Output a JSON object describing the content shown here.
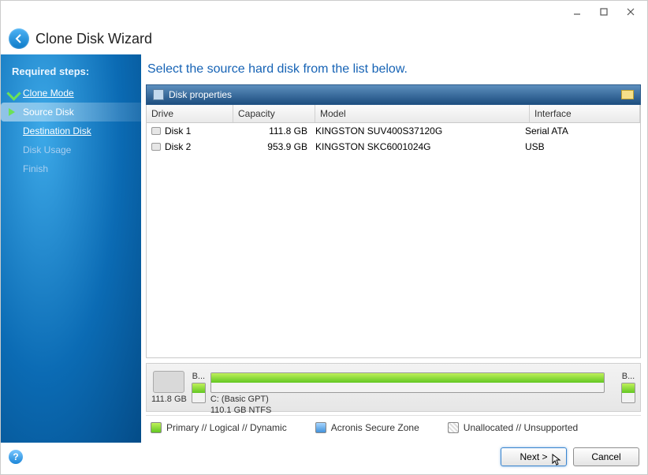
{
  "header": {
    "title": "Clone Disk Wizard"
  },
  "sidebar": {
    "section": "Required steps:",
    "steps": [
      {
        "label": "Clone Mode",
        "state": "completed"
      },
      {
        "label": "Source Disk",
        "state": "current"
      },
      {
        "label": "Destination Disk",
        "state": "link"
      },
      {
        "label": "Disk Usage",
        "state": "disabled"
      },
      {
        "label": "Finish",
        "state": "disabled"
      }
    ]
  },
  "main": {
    "title": "Select the source hard disk from the list below.",
    "panel_title": "Disk properties",
    "columns": {
      "drive": "Drive",
      "capacity": "Capacity",
      "model": "Model",
      "interface": "Interface"
    },
    "rows": [
      {
        "drive": "Disk 1",
        "capacity": "111.8 GB",
        "model": "KINGSTON SUV400S37120G",
        "interface": "Serial ATA"
      },
      {
        "drive": "Disk 2",
        "capacity": "953.9 GB",
        "model": "KINGSTON SKC6001024G",
        "interface": "USB"
      }
    ]
  },
  "strip": {
    "disk_size": "111.8 GB",
    "part1_top": "B...",
    "part_label": "C: (Basic GPT)",
    "part_sub": "110.1 GB  NTFS",
    "part2_top": "B..."
  },
  "legend": {
    "primary": "Primary // Logical // Dynamic",
    "secure": "Acronis Secure Zone",
    "unalloc": "Unallocated // Unsupported"
  },
  "footer": {
    "next": "Next >",
    "cancel": "Cancel"
  }
}
